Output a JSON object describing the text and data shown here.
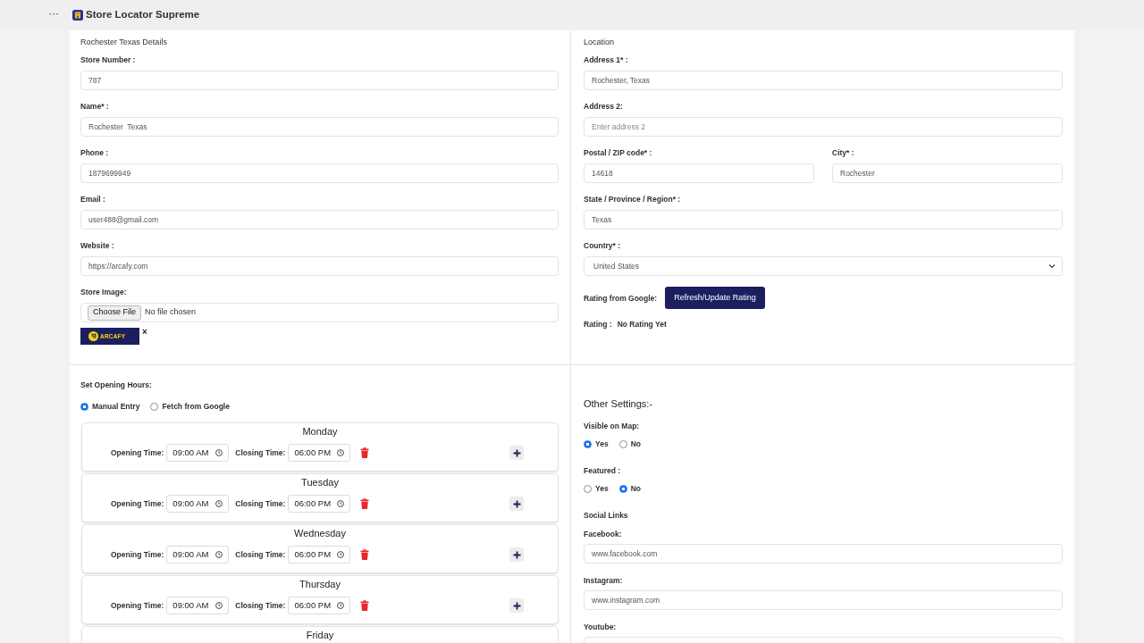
{
  "top_bar": {
    "menu": "···",
    "title": "Store Locator Supreme"
  },
  "details": {
    "heading": "Rochester Texas Details",
    "fields": [
      {
        "kind": "text",
        "label": "Store Number :",
        "value": "787"
      },
      {
        "kind": "text",
        "label": "Name* :",
        "value": "Rochester  Texas"
      },
      {
        "kind": "text",
        "label": "Phone :",
        "value": "1879699949"
      },
      {
        "kind": "text",
        "label": "Email :",
        "value": "user488@gmail.com"
      },
      {
        "kind": "text",
        "label": "Website :",
        "value": "https://arcafy.com"
      },
      {
        "kind": "file",
        "label": "Store Image:",
        "button": "Choose File",
        "status": "No file chosen",
        "preview": {
          "logo_text": "ARCAFY",
          "remove": "×"
        }
      }
    ]
  },
  "location": {
    "heading": "Location",
    "rows": [
      [
        {
          "kind": "text",
          "label": "Address 1* :",
          "value": "Rochester, Texas"
        }
      ],
      [
        {
          "kind": "text",
          "label": "Address 2:",
          "placeholder": "Enter address 2"
        }
      ],
      [
        {
          "kind": "text",
          "label": "Postal / ZIP code* :",
          "value": "14618"
        },
        {
          "kind": "text",
          "label": "City* :",
          "value": "Rochester"
        }
      ],
      [
        {
          "kind": "text",
          "label": "State / Province / Region* :",
          "value": "Texas"
        }
      ],
      [
        {
          "kind": "select",
          "label": "Country* :",
          "value": "United States"
        }
      ]
    ],
    "rating": {
      "source_label": "Rating from Google:",
      "button": "Refresh/Update Rating",
      "label": "Rating :",
      "value": "No Rating Yet"
    }
  },
  "opening_hours": {
    "heading": "Set Opening Hours:",
    "modes": [
      {
        "label": "Manual Entry",
        "selected": true
      },
      {
        "label": "Fetch from Google",
        "selected": false
      }
    ],
    "days": [
      {
        "day": "Monday",
        "opening_label": "Opening Time:",
        "opening": "09:00 AM",
        "closing_label": "Closing Time:",
        "closing": "06:00 PM"
      },
      {
        "day": "Tuesday",
        "opening_label": "Opening Time:",
        "opening": "09:00 AM",
        "closing_label": "Closing Time:",
        "closing": "06:00 PM"
      },
      {
        "day": "Wednesday",
        "opening_label": "Opening Time:",
        "opening": "09:00 AM",
        "closing_label": "Closing Time:",
        "closing": "06:00 PM"
      },
      {
        "day": "Thursday",
        "opening_label": "Opening Time:",
        "opening": "09:00 AM",
        "closing_label": "Closing Time:",
        "closing": "06:00 PM"
      },
      {
        "day": "Friday"
      }
    ]
  },
  "other_settings": {
    "heading": "Other Settings:-",
    "groups": [
      {
        "label": "Visible on Map:",
        "options": [
          {
            "label": "Yes",
            "selected": true
          },
          {
            "label": "No",
            "selected": false
          }
        ]
      },
      {
        "label": "Featured :",
        "options": [
          {
            "label": "Yes",
            "selected": false
          },
          {
            "label": "No",
            "selected": true
          }
        ]
      }
    ],
    "social": {
      "heading": "Social Links",
      "fields": [
        {
          "kind": "text",
          "label": "Facebook:",
          "value": "www.facebook.com"
        },
        {
          "kind": "text",
          "label": "Instagram:",
          "value": "www.instagram.com"
        },
        {
          "kind": "text",
          "label": "Youtube:"
        }
      ]
    }
  }
}
